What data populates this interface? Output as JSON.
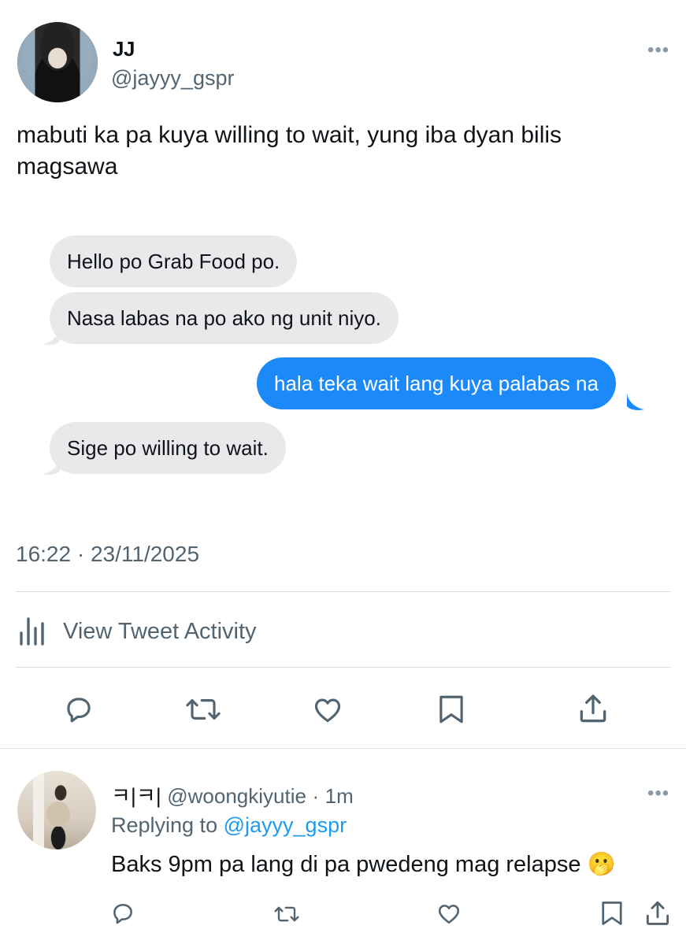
{
  "tweet": {
    "display_name": "JJ",
    "handle": "@jayyy_gspr",
    "more_label": "•••",
    "text": "mabuti ka pa kuya willing to wait, yung iba dyan bilis magsawa",
    "timestamp": "16:22 · 23/11/2025"
  },
  "chat": {
    "messages": [
      {
        "side": "incoming",
        "text": "Hello po Grab Food po."
      },
      {
        "side": "incoming",
        "text": "Nasa labas na po ako ng unit niyo."
      },
      {
        "side": "outgoing",
        "text": "hala teka wait lang kuya palabas na"
      },
      {
        "side": "incoming",
        "text": "Sige po willing to wait."
      }
    ],
    "incoming_color": "#e9e9eb",
    "outgoing_color": "#1b8af8"
  },
  "activity": {
    "label": "View Tweet Activity",
    "icon": "bar-chart-icon"
  },
  "actions": [
    {
      "name": "reply",
      "icon": "speech-bubble-icon"
    },
    {
      "name": "retweet",
      "icon": "retweet-arrows-icon"
    },
    {
      "name": "like",
      "icon": "heart-icon"
    },
    {
      "name": "bookmark",
      "icon": "bookmark-icon"
    },
    {
      "name": "share",
      "icon": "share-upload-icon"
    }
  ],
  "reply": {
    "display_name": "ㅋ|ㅋ|",
    "handle": "@woongkiyutie",
    "separator": "·",
    "time": "1m",
    "replying_prefix": "Replying to",
    "replying_handle": "@jayyy_gspr",
    "text": "Baks 9pm pa lang di pa pwedeng mag relapse 🫢",
    "more_label": "•••"
  },
  "colors": {
    "link": "#1d9bf0",
    "secondary_text": "#536471",
    "primary_text": "#0f1419"
  }
}
